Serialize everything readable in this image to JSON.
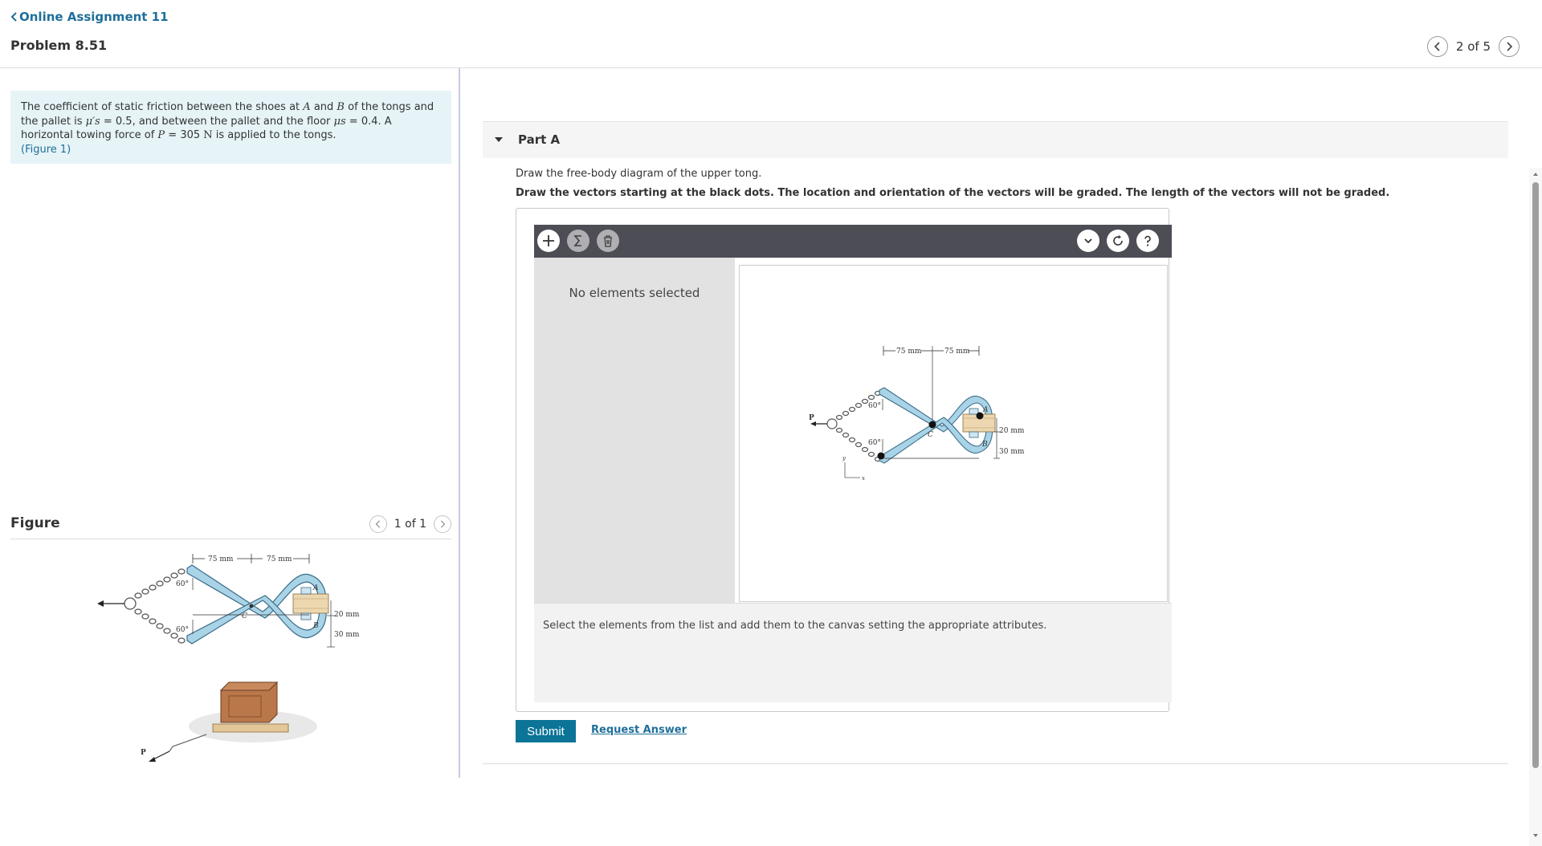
{
  "header": {
    "back_link": "Online Assignment 11",
    "problem_title": "Problem 8.51",
    "pager_text": "2 of 5"
  },
  "problem": {
    "text_1": "The coefficient of static friction between the shoes at ",
    "A": "A",
    "text_2": " and ",
    "B": "B",
    "text_3": " of the tongs and the pallet is ",
    "mu_s_prime": "μ′s",
    "text_4": " = 0.5, and between the pallet and the floor ",
    "mu_s": "μs",
    "text_5": " = 0.4. A horizontal towing force of ",
    "P": "P",
    "text_6": " = 305  ",
    "N": "N",
    "text_7": " is applied to the tongs.",
    "figure_link": "(Figure 1)"
  },
  "figure": {
    "title": "Figure",
    "pager_text": "1 of 1",
    "labels": {
      "dim_75a": "75 mm",
      "dim_75b": "75 mm",
      "angle_top": "60°",
      "angle_bot": "60°",
      "P": "P",
      "A": "A",
      "B": "B",
      "C": "C",
      "dim_20": "20 mm",
      "dim_30": "30 mm"
    }
  },
  "part": {
    "title": "Part A",
    "instruction": "Draw the free-body diagram of the upper tong.",
    "instruction_bold": "Draw the vectors starting at the black dots. The location and orientation of the vectors will be graded. The length of the vectors will not be graded."
  },
  "tool": {
    "side_text": "No elements selected",
    "bottom_text": "Select the elements from the list and add them to the canvas setting the appropriate attributes.",
    "canvas_labels": {
      "dim_75a": "75 mm",
      "dim_75b": "75 mm",
      "angle_top": "60°",
      "angle_bot": "60°",
      "P": "P",
      "A": "A",
      "B": "B",
      "C": "C",
      "dim_20": "20 mm",
      "dim_30": "30 mm",
      "axis_y": "y",
      "axis_x": "x"
    }
  },
  "actions": {
    "submit": "Submit",
    "request_answer": "Request Answer"
  },
  "colors": {
    "link": "#1f6f9a",
    "submit_bg": "#0b7497",
    "problem_bg": "#e6f4f7",
    "toolbar_bg": "#4d4d56",
    "tong_fill": "#a9d3e6",
    "tong_stroke": "#3a6d8a"
  }
}
